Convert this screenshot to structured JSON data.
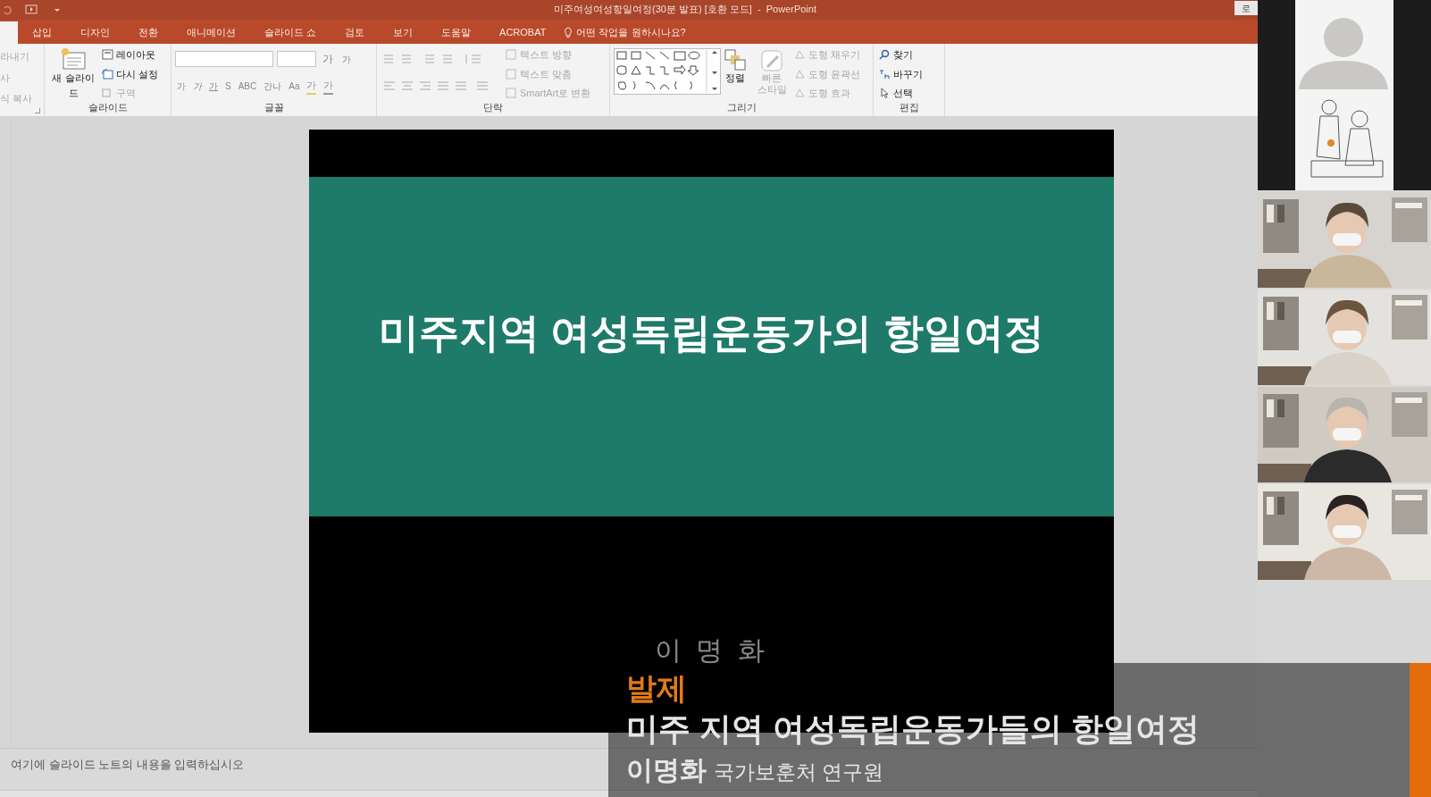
{
  "title_bar": {
    "title": "미주여성여성항일여정(30분 발표) [호환 모드]  -  PowerPoint",
    "account": "로"
  },
  "tabs": [
    {
      "label": "삽입",
      "selected": false
    },
    {
      "label": "디자인",
      "selected": false
    },
    {
      "label": "전환",
      "selected": false
    },
    {
      "label": "애니메이션",
      "selected": false
    },
    {
      "label": "슬라이드 쇼",
      "selected": false
    },
    {
      "label": "검토",
      "selected": false
    },
    {
      "label": "보기",
      "selected": false
    },
    {
      "label": "도움말",
      "selected": false
    },
    {
      "label": "ACROBAT",
      "selected": false
    }
  ],
  "tell_me": "어떤 작업을 원하시나요?",
  "ribbon": {
    "clipboard": [
      {
        "label": "라내기",
        "disabled": true
      },
      {
        "label": "사",
        "disabled": true
      },
      {
        "label": "식 복사",
        "disabled": true
      }
    ],
    "slides": {
      "label": "슬라이드",
      "new_slide": "새 슬라이드",
      "items": [
        {
          "label": "레이아웃",
          "disabled": false
        },
        {
          "label": "다시 설정",
          "disabled": false
        },
        {
          "label": "구역",
          "disabled": true
        }
      ]
    },
    "font": {
      "label": "글꼴",
      "grow": "가",
      "shrink": "가",
      "buttons": [
        "가",
        "가",
        "가",
        "S",
        "ABC",
        "간나",
        "Aa"
      ],
      "highlight": "가",
      "font_color_button": "가"
    },
    "paragraph": {
      "label": "단락",
      "items": [
        {
          "label": "텍스트 방향",
          "disabled": true
        },
        {
          "label": "텍스트 맞춤",
          "disabled": true
        },
        {
          "label": "SmartArt로 변환",
          "disabled": true
        }
      ]
    },
    "drawing": {
      "label": "그리기",
      "arrange": "정렬",
      "quick_styles": "빠른 스타일",
      "items": [
        {
          "label": "도형 채우기",
          "disabled": true
        },
        {
          "label": "도형 윤곽선",
          "disabled": true
        },
        {
          "label": "도형 효과",
          "disabled": true
        }
      ]
    },
    "editing": {
      "label": "편집",
      "items": [
        {
          "label": "찾기",
          "disabled": false
        },
        {
          "label": "바꾸기",
          "disabled": false
        },
        {
          "label": "선택",
          "disabled": false
        }
      ]
    }
  },
  "slide": {
    "title": "미주지역 여성독립운동가의 항일여정",
    "subtitle": "이 명 화"
  },
  "notes": {
    "placeholder": "여기에 슬라이드 노트의 내용을 입력하십시오"
  },
  "caption": {
    "tag": "발제",
    "title": "미주 지역 여성독립운동가들의 항일여정",
    "speaker": "이명화",
    "affiliation": "국가보훈처 연구원"
  },
  "participants": [
    {
      "kind": "avatar"
    },
    {
      "kind": "camera"
    },
    {
      "kind": "camera"
    },
    {
      "kind": "camera"
    },
    {
      "kind": "camera"
    }
  ]
}
